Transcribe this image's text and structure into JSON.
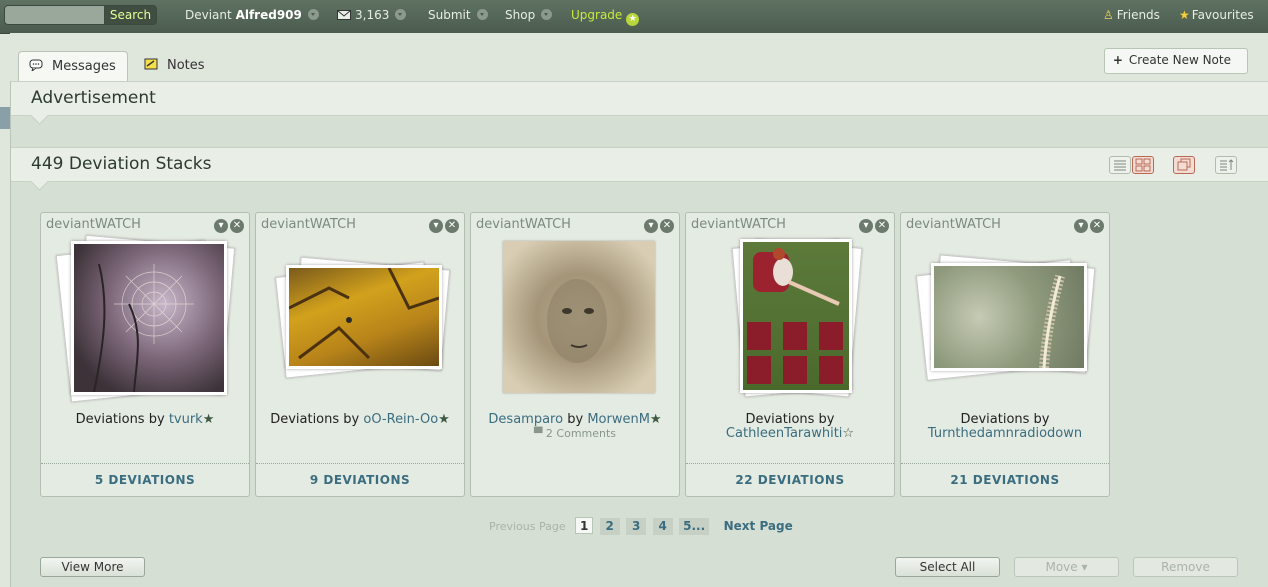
{
  "topbar": {
    "search_label": "Search",
    "user_prefix": "Deviant",
    "username": "Alfred909",
    "message_count": "3,163",
    "submit": "Submit",
    "shop": "Shop",
    "upgrade": "Upgrade",
    "friends": "Friends",
    "favourites": "Favourites"
  },
  "tabs": {
    "messages": "Messages",
    "notes": "Notes",
    "create_note": "Create New Note"
  },
  "advertisement": {
    "title": "Advertisement"
  },
  "stacks": {
    "title": "449 Deviation Stacks",
    "cards": [
      {
        "source": "deviantWATCH",
        "prefix": "Deviations by",
        "artist": "tvurk",
        "artist_mark": "★",
        "count": "5 DEVIATIONS"
      },
      {
        "source": "deviantWATCH",
        "prefix": "Deviations by",
        "artist": "oO-Rein-Oo",
        "artist_mark": "★",
        "count": "9 DEVIATIONS"
      },
      {
        "source": "deviantWATCH",
        "work_title": "Desamparo",
        "prefix": "by",
        "artist": "MorwenM",
        "artist_mark": "★",
        "comments": "2 Comments",
        "count": ""
      },
      {
        "source": "deviantWATCH",
        "prefix": "Deviations by",
        "artist": "CathleenTarawhiti",
        "artist_mark": "☆",
        "count": "22 DEVIATIONS"
      },
      {
        "source": "deviantWATCH",
        "prefix": "Deviations by",
        "artist": "Turnthedamnradiodown",
        "count": "21 DEVIATIONS"
      }
    ]
  },
  "pagination": {
    "previous": "Previous Page",
    "pages": [
      "1",
      "2",
      "3",
      "4",
      "5..."
    ],
    "next": "Next Page"
  },
  "actions": {
    "view_more": "View More",
    "select_all": "Select All",
    "move": "Move ▾",
    "remove": "Remove"
  },
  "colors": {
    "topbar": "#4f6052",
    "link": "#3b6d80",
    "upgrade": "#c6ea3b",
    "panel": "#d6dfd4"
  }
}
